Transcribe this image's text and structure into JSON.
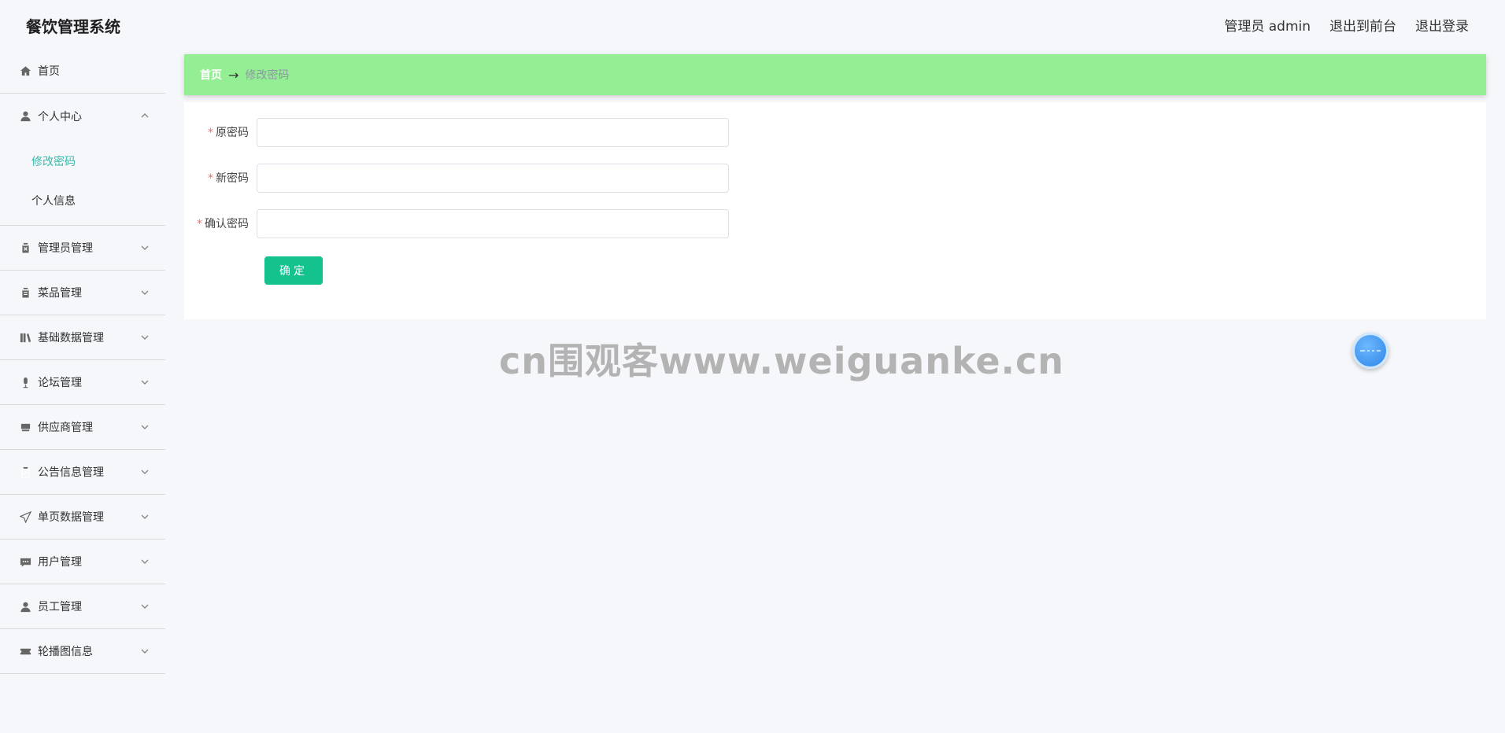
{
  "header": {
    "title": "餐饮管理系统",
    "admin_label": "管理员 admin",
    "back_front": "退出到前台",
    "logout": "退出登录"
  },
  "sidebar": {
    "items": [
      {
        "label": "首页",
        "icon": "home-icon"
      },
      {
        "label": "个人中心",
        "icon": "user-icon",
        "open": true,
        "children": [
          {
            "label": "修改密码",
            "active": true
          },
          {
            "label": "个人信息"
          }
        ]
      },
      {
        "label": "管理员管理",
        "icon": "clipboard-x-icon"
      },
      {
        "label": "菜品管理",
        "icon": "clipboard-icon"
      },
      {
        "label": "基础数据管理",
        "icon": "books-icon"
      },
      {
        "label": "论坛管理",
        "icon": "microphone-icon"
      },
      {
        "label": "供应商管理",
        "icon": "tray-icon"
      },
      {
        "label": "公告信息管理",
        "icon": "clipboard-check-icon"
      },
      {
        "label": "单页数据管理",
        "icon": "send-icon"
      },
      {
        "label": "用户管理",
        "icon": "chat-icon"
      },
      {
        "label": "员工管理",
        "icon": "user-icon"
      },
      {
        "label": "轮播图信息",
        "icon": "ticket-icon"
      }
    ]
  },
  "breadcrumb": {
    "home": "首页",
    "separator": "→",
    "current": "修改密码"
  },
  "form": {
    "old_password_label": "原密码",
    "new_password_label": "新密码",
    "confirm_password_label": "确认密码",
    "required_mark": "*",
    "old_password_value": "",
    "new_password_value": "",
    "confirm_password_value": "",
    "submit_label": "确定"
  },
  "watermark": "cn围观客www.weiguanke.cn",
  "colors": {
    "breadcrumb_bg": "#94ee94",
    "accent": "#3bb9a9",
    "button": "#13c28c",
    "required": "#f56c6c"
  }
}
